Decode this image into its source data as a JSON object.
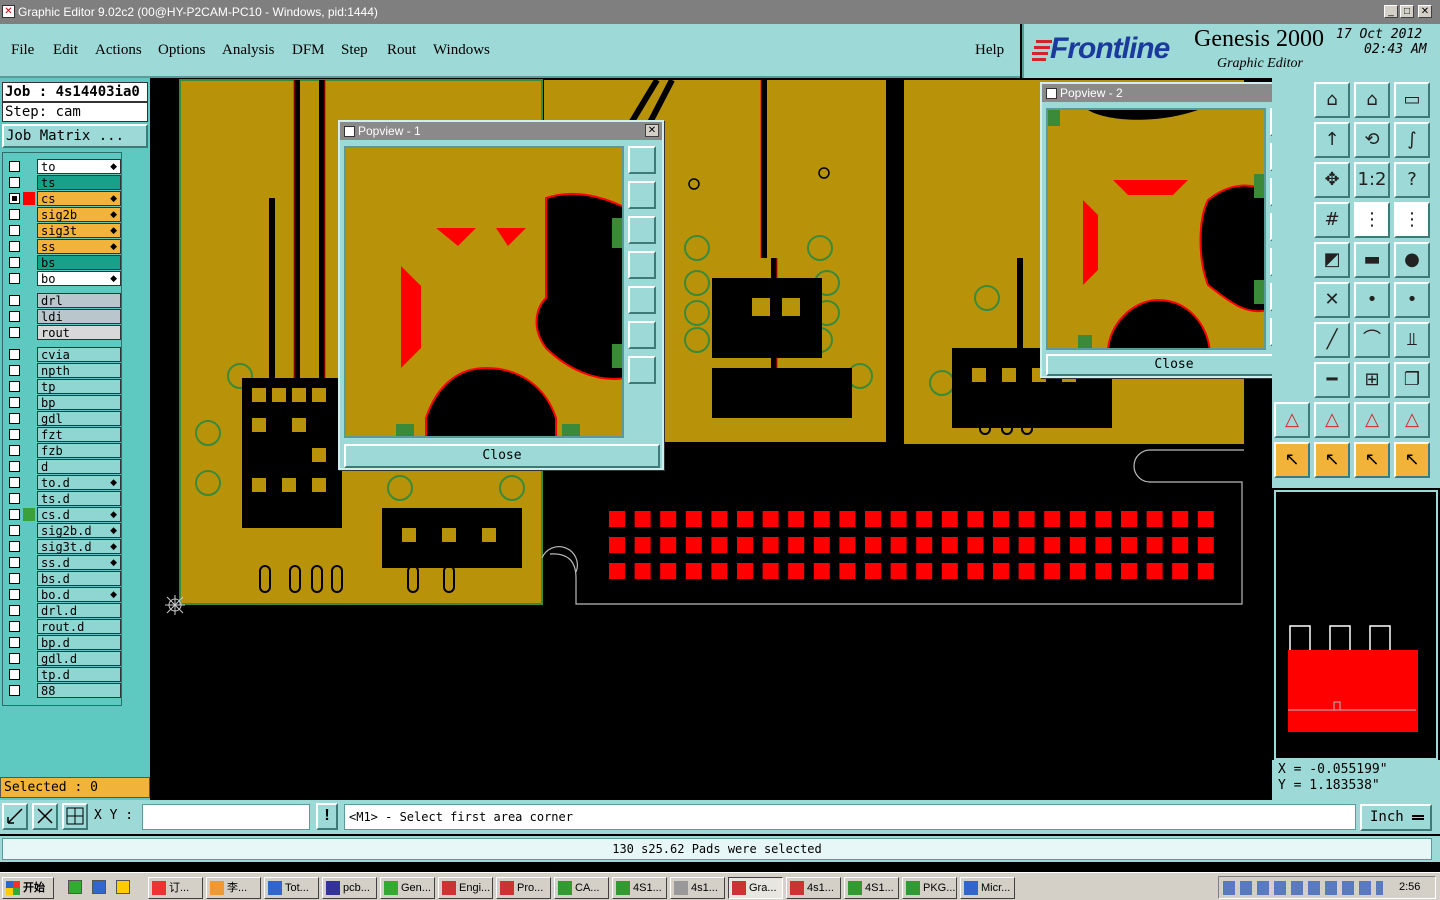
{
  "window": {
    "title": "Graphic Editor 9.02c2 (00@HY-P2CAM-PC10 - Windows, pid:1444)"
  },
  "menu": {
    "items": [
      "File",
      "Edit",
      "Actions",
      "Options",
      "Analysis",
      "DFM",
      "Step",
      "Rout",
      "Windows"
    ],
    "help": "Help"
  },
  "brand": {
    "logo": "Frontline",
    "product": "Genesis 2000",
    "subtitle": "Graphic Editor",
    "date": "17 Oct 2012",
    "time": "02:43 AM"
  },
  "left": {
    "job": "Job : 4s14403ia0",
    "step": "Step: cam",
    "job_matrix": "Job Matrix ...",
    "selected": "Selected : 0"
  },
  "layers": [
    {
      "name": "to",
      "color": "#ffffff",
      "ind": "",
      "flag": true
    },
    {
      "name": "ts",
      "color": "#17a08a",
      "ind": "",
      "flag": false
    },
    {
      "name": "cs",
      "color": "#f2b33a",
      "ind": "#ff0000",
      "flag": true,
      "active": true
    },
    {
      "name": "sig2b",
      "color": "#f2b33a",
      "ind": "",
      "flag": true
    },
    {
      "name": "sig3t",
      "color": "#f2b33a",
      "ind": "",
      "flag": true
    },
    {
      "name": "ss",
      "color": "#f2b33a",
      "ind": "",
      "flag": true
    },
    {
      "name": "bs",
      "color": "#17a08a",
      "ind": "",
      "flag": false
    },
    {
      "name": "bo",
      "color": "#ffffff",
      "ind": "",
      "flag": true
    },
    {
      "name": "drl",
      "color": "#b9c6cc",
      "ind": "",
      "flag": false
    },
    {
      "name": "ldi",
      "color": "#b9c6cc",
      "ind": "",
      "flag": false
    },
    {
      "name": "rout",
      "color": "#d8d8d8",
      "ind": "",
      "flag": false
    },
    {
      "name": "cvia",
      "color": "#8fd6d2",
      "ind": "",
      "flag": false
    },
    {
      "name": "npth",
      "color": "#8fd6d2",
      "ind": "",
      "flag": false
    },
    {
      "name": "tp",
      "color": "#8fd6d2",
      "ind": "",
      "flag": false
    },
    {
      "name": "bp",
      "color": "#8fd6d2",
      "ind": "",
      "flag": false
    },
    {
      "name": "gdl",
      "color": "#8fd6d2",
      "ind": "",
      "flag": false
    },
    {
      "name": "fzt",
      "color": "#8fd6d2",
      "ind": "",
      "flag": false
    },
    {
      "name": "fzb",
      "color": "#8fd6d2",
      "ind": "",
      "flag": false
    },
    {
      "name": "d",
      "color": "#8fd6d2",
      "ind": "",
      "flag": false
    },
    {
      "name": "to.d",
      "color": "#8fd6d2",
      "ind": "",
      "flag": true
    },
    {
      "name": "ts.d",
      "color": "#8fd6d2",
      "ind": "",
      "flag": false
    },
    {
      "name": "cs.d",
      "color": "#8fd6d2",
      "ind": "#3aa13a",
      "flag": true
    },
    {
      "name": "sig2b.d",
      "color": "#8fd6d2",
      "ind": "",
      "flag": true
    },
    {
      "name": "sig3t.d",
      "color": "#8fd6d2",
      "ind": "",
      "flag": true
    },
    {
      "name": "ss.d",
      "color": "#8fd6d2",
      "ind": "",
      "flag": true
    },
    {
      "name": "bs.d",
      "color": "#8fd6d2",
      "ind": "",
      "flag": false
    },
    {
      "name": "bo.d",
      "color": "#8fd6d2",
      "ind": "",
      "flag": true
    },
    {
      "name": "drl.d",
      "color": "#8fd6d2",
      "ind": "",
      "flag": false
    },
    {
      "name": "rout.d",
      "color": "#8fd6d2",
      "ind": "",
      "flag": false
    },
    {
      "name": "bp.d",
      "color": "#8fd6d2",
      "ind": "",
      "flag": false
    },
    {
      "name": "gdl.d",
      "color": "#8fd6d2",
      "ind": "",
      "flag": false
    },
    {
      "name": "tp.d",
      "color": "#8fd6d2",
      "ind": "",
      "flag": false
    },
    {
      "name": "88",
      "color": "#8fd6d2",
      "ind": "",
      "flag": false
    }
  ],
  "popview1": {
    "title": "Popview - 1",
    "close": "Close"
  },
  "popview2": {
    "title": "Popview - 2",
    "close": "Close"
  },
  "coords": {
    "x": "X = -0.055199\"",
    "y": "Y = 1.183538\""
  },
  "bottom": {
    "xy_label": "X Y :",
    "xy_value": "",
    "prompt": "<M1> - Select first area corner",
    "unit": "Inch"
  },
  "status": "130 s25.62 Pads were selected",
  "taskbar": {
    "start": "开始",
    "tasks": [
      "订...",
      "李...",
      "Tot...",
      "pcb...",
      "Gen...",
      "Engi...",
      "Pro...",
      "CA...",
      "4S1...",
      "4s1...",
      "Gra...",
      "4s1...",
      "4S1...",
      "PKG...",
      "Micr..."
    ],
    "clock": "2:56"
  },
  "colors": {
    "teal": "#9dd9d6",
    "board": "#b8930a",
    "copper": "#ff0000"
  }
}
